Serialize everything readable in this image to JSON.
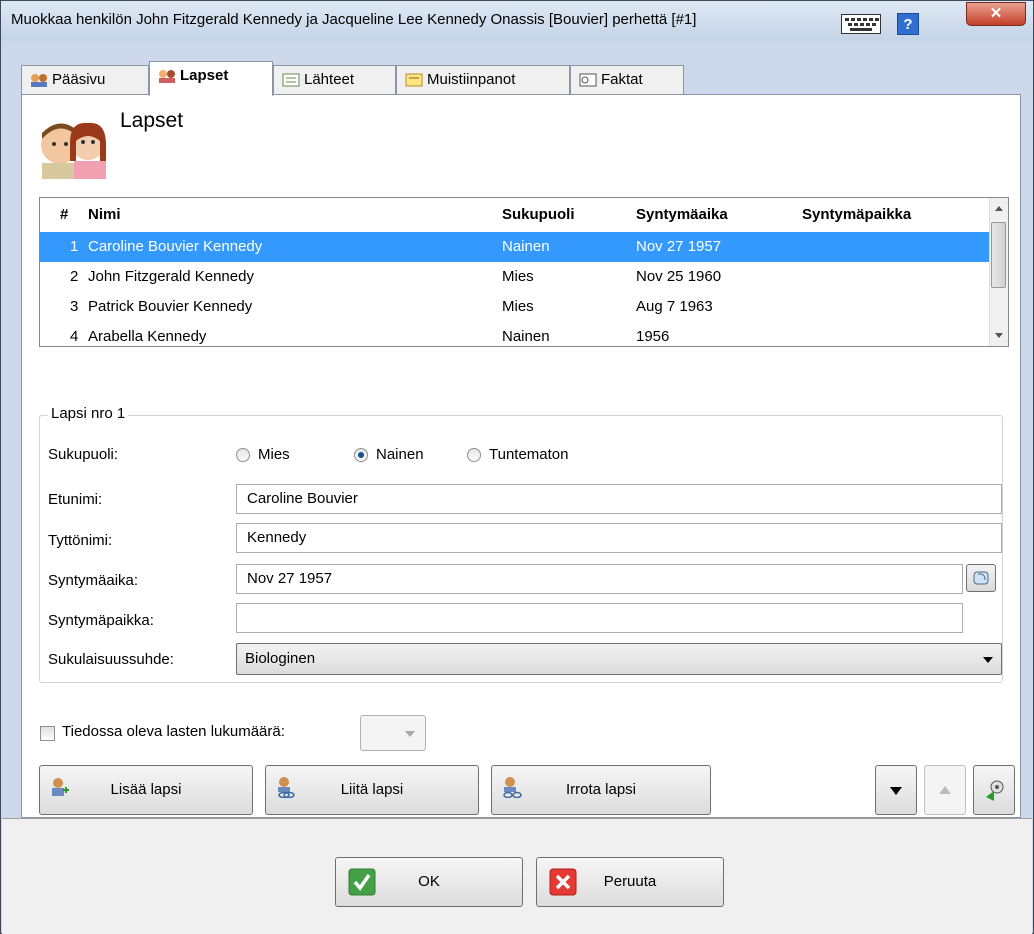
{
  "window": {
    "title": "Muokkaa henkilön John Fitzgerald Kennedy ja Jacqueline Lee Kennedy Onassis [Bouvier] perhettä [#1]",
    "help_label": "?",
    "close_label": "✕"
  },
  "tabs": [
    {
      "label": "Pääsivu",
      "icon": "people-icon"
    },
    {
      "label": "Lapset",
      "icon": "children-icon",
      "active": true
    },
    {
      "label": "Lähteet",
      "icon": "sources-icon"
    },
    {
      "label": "Muistiinpanot",
      "icon": "notes-icon"
    },
    {
      "label": "Faktat",
      "icon": "facts-icon"
    }
  ],
  "heading": "Lapset",
  "children_table": {
    "columns": [
      "#",
      "Nimi",
      "Sukupuoli",
      "Syntymäaika",
      "Syntymäpaikka"
    ],
    "rows": [
      {
        "num": "1",
        "name": "Caroline Bouvier Kennedy",
        "gender": "Nainen",
        "birth_date": "Nov 27 1957",
        "birth_place": "",
        "selected": true
      },
      {
        "num": "2",
        "name": "John Fitzgerald Kennedy",
        "gender": "Mies",
        "birth_date": "Nov 25 1960",
        "birth_place": ""
      },
      {
        "num": "3",
        "name": "Patrick Bouvier Kennedy",
        "gender": "Mies",
        "birth_date": "Aug 7 1963",
        "birth_place": ""
      },
      {
        "num": "4",
        "name": "Arabella Kennedy",
        "gender": "Nainen",
        "birth_date": "1956",
        "birth_place": ""
      }
    ]
  },
  "detail": {
    "legend": "Lapsi nro 1",
    "gender_label": "Sukupuoli:",
    "gender_options": [
      "Mies",
      "Nainen",
      "Tuntematon"
    ],
    "gender_selected": "Nainen",
    "first_name_label": "Etunimi:",
    "first_name_value": "Caroline Bouvier",
    "maiden_name_label": "Tyttönimi:",
    "maiden_name_value": "Kennedy",
    "birth_date_label": "Syntymäaika:",
    "birth_date_value": "Nov 27 1957",
    "birth_place_label": "Syntymäpaikka:",
    "birth_place_value": "",
    "relation_label": "Sukulaisuussuhde:",
    "relation_value": "Biologinen"
  },
  "known_children": {
    "label": "Tiedossa oleva lasten lukumäärä:",
    "checked": false
  },
  "actions": {
    "add_child": "Lisää lapsi",
    "link_child": "Liitä lapsi",
    "detach_child": "Irrota lapsi"
  },
  "footer": {
    "ok": "OK",
    "cancel": "Peruuta"
  },
  "colors": {
    "selection": "#3399ff",
    "ok_green": "#4caf50",
    "cancel_red": "#e53935",
    "help_blue": "#2e6fd0"
  }
}
